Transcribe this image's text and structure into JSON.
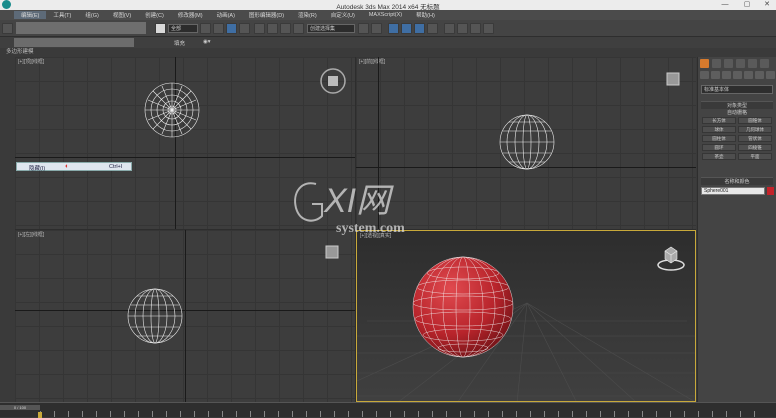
{
  "window": {
    "title": "Autodesk 3ds Max  2014 x64    无标题",
    "minimize": "—",
    "maximize": "▢",
    "close": "✕"
  },
  "menu": [
    "编辑(E)",
    "工具(T)",
    "组(G)",
    "视图(V)",
    "创建(C)",
    "修改器(M)",
    "动画(A)",
    "图形编辑器(D)",
    "渲染(R)",
    "自定义(U)",
    "MAXScript(X)",
    "帮助(H)"
  ],
  "toolbar": {
    "selection_filter": "全部",
    "view_dropdown": "视图",
    "named_selection": "创建选择集"
  },
  "ribbon": {
    "tab_label": "填充",
    "sub_label": "多边形建模"
  },
  "viewports": {
    "top": "[+][顶][线框]",
    "front": "[+][前][线框]",
    "left": "[+][左][线框]",
    "perspective": "[+][透视][真实]"
  },
  "context_menu": {
    "item": "隐藏(I)",
    "shortcut": "Ctrl+I"
  },
  "command_panel": {
    "category_dropdown": "标准基本体",
    "section_object_type": "对象类型",
    "auto_grid": "自动栅格",
    "buttons": [
      "长方体",
      "圆锥体",
      "球体",
      "几何球体",
      "圆柱体",
      "管状体",
      "圆环",
      "四棱锥",
      "茶壶",
      "平面"
    ],
    "section_name_color": "名称和颜色",
    "object_name": "Sphere001",
    "object_color": "#c4232a"
  },
  "timeline": {
    "slider_label": "0 / 100"
  },
  "watermark": {
    "brand": "GXI网",
    "domain": "system.com"
  }
}
